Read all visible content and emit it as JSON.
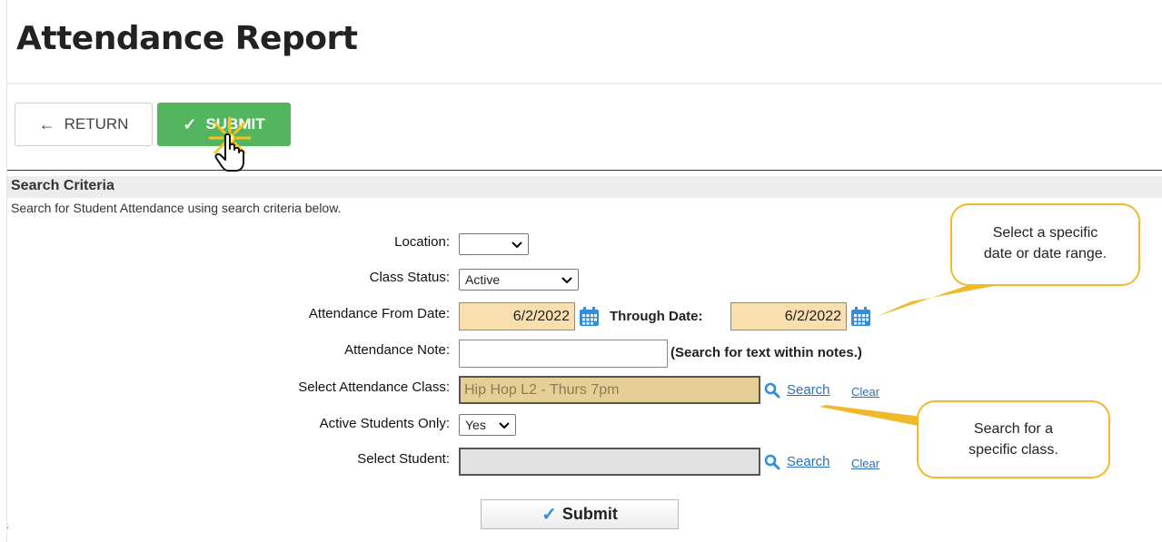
{
  "header": {
    "title": "Attendance Report"
  },
  "toolbar": {
    "return_label": "RETURN",
    "submit_label": "SUBMIT"
  },
  "search_criteria": {
    "title": "Search Criteria",
    "description": "Search for Student Attendance using search criteria below.",
    "location": {
      "label": "Location:",
      "value": ""
    },
    "class_status": {
      "label": "Class Status:",
      "value": "Active"
    },
    "from_date": {
      "label": "Attendance From Date:",
      "value": "6/2/2022"
    },
    "through_date": {
      "label": "Through Date:",
      "value": "6/2/2022"
    },
    "note": {
      "label": "Attendance Note:",
      "value": "",
      "hint": "(Search for text within notes.)"
    },
    "attendance_class": {
      "label": "Select Attendance Class:",
      "value": "Hip Hop L2 - Thurs 7pm",
      "search_label": "Search",
      "clear_label": "Clear"
    },
    "active_students": {
      "label": "Active Students Only:",
      "value": "Yes"
    },
    "student": {
      "label": "Select Student:",
      "value": "",
      "search_label": "Search",
      "clear_label": "Clear"
    },
    "submit_label": "Submit"
  },
  "callouts": {
    "date_tip_line1": "Select a specific",
    "date_tip_line2": "date or date range.",
    "class_tip_line1": "Search for a",
    "class_tip_line2": "specific class."
  },
  "misc": {
    "stray_mark": "."
  },
  "colors": {
    "accent_green": "#53b65e",
    "date_fill": "#fadfae",
    "callout_border": "#f0b929",
    "link": "#2b6fb8"
  },
  "icons": [
    "arrow-left-icon",
    "check-icon",
    "hand-pointer-icon",
    "calendar-icon",
    "search-icon",
    "chevron-down-icon"
  ]
}
